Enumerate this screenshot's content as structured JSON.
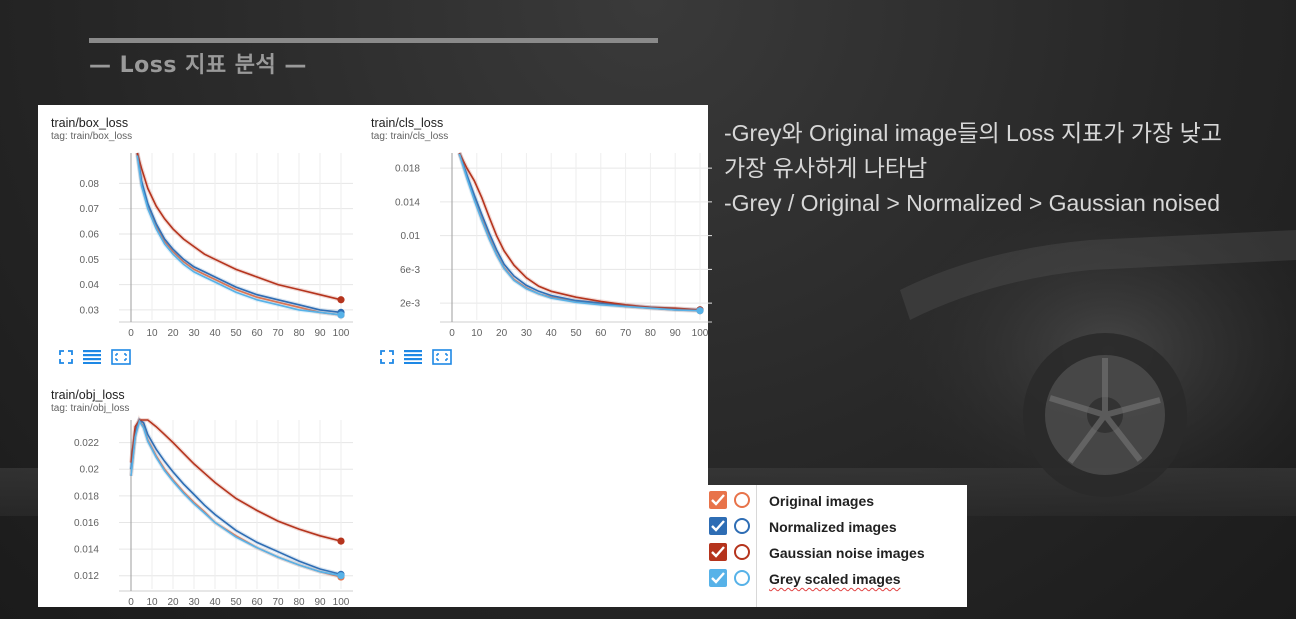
{
  "slide": {
    "title": "— Loss 지표 분석 —"
  },
  "description": {
    "line1": "-Grey와 Original image들의 Loss 지표가 가장 낮고",
    "line2": "가장 유사하게 나타남",
    "line3": "-Grey / Original > Normalized > Gaussian noised"
  },
  "legend": {
    "items": [
      {
        "label": "Original images",
        "color": "#e8734a",
        "checked": true
      },
      {
        "label": "Normalized images",
        "color": "#2e6db4",
        "checked": true
      },
      {
        "label": "Gaussian noise images",
        "color": "#b5341d",
        "checked": true
      },
      {
        "label": "Grey scaled images",
        "color": "#57b2e8",
        "checked": true
      }
    ]
  },
  "controls": {
    "icons": [
      "expand-icon",
      "list-icon",
      "fit-domain-icon"
    ]
  },
  "chart_data": [
    {
      "type": "line",
      "title": "train/box_loss",
      "tag": "tag: train/box_loss",
      "xlim": [
        0,
        100
      ],
      "ylim": [
        0.026,
        0.092
      ],
      "x_ticks": [
        0,
        10,
        20,
        30,
        40,
        50,
        60,
        70,
        80,
        90,
        100
      ],
      "y_ticks": [
        0.03,
        0.04,
        0.05,
        0.06,
        0.07,
        0.08
      ],
      "y_tick_labels": [
        "0.03",
        "0.04",
        "0.05",
        "0.06",
        "0.07",
        "0.08"
      ],
      "x": [
        3,
        5,
        8,
        12,
        16,
        20,
        25,
        30,
        35,
        40,
        50,
        60,
        70,
        80,
        90,
        100
      ],
      "series": [
        {
          "color": "#e8734a",
          "values": [
            0.092,
            0.08,
            0.071,
            0.063,
            0.057,
            0.053,
            0.049,
            0.046,
            0.044,
            0.042,
            0.038,
            0.035,
            0.033,
            0.031,
            0.029,
            0.028
          ]
        },
        {
          "color": "#2e6db4",
          "values": [
            0.092,
            0.081,
            0.072,
            0.064,
            0.058,
            0.054,
            0.05,
            0.047,
            0.045,
            0.043,
            0.039,
            0.036,
            0.034,
            0.032,
            0.03,
            0.029
          ]
        },
        {
          "color": "#b5341d",
          "values": [
            0.092,
            0.086,
            0.078,
            0.071,
            0.066,
            0.062,
            0.058,
            0.055,
            0.052,
            0.05,
            0.046,
            0.043,
            0.04,
            0.038,
            0.036,
            0.034
          ]
        },
        {
          "color": "#57b2e8",
          "values": [
            0.091,
            0.079,
            0.07,
            0.062,
            0.056,
            0.052,
            0.048,
            0.045,
            0.043,
            0.041,
            0.037,
            0.034,
            0.032,
            0.03,
            0.029,
            0.028
          ]
        }
      ]
    },
    {
      "type": "line",
      "title": "train/cls_loss",
      "tag": "tag: train/cls_loss",
      "xlim": [
        0,
        100
      ],
      "ylim": [
        0,
        0.0198
      ],
      "x_ticks": [
        0,
        10,
        20,
        30,
        40,
        50,
        60,
        70,
        80,
        90,
        100
      ],
      "y_ticks": [
        0.002,
        0.006,
        0.01,
        0.014,
        0.018
      ],
      "y_tick_labels": [
        "2e-3",
        "6e-3",
        "0.01",
        "0.014",
        "0.018"
      ],
      "x": [
        3,
        6,
        9,
        12,
        15,
        18,
        21,
        25,
        30,
        35,
        40,
        50,
        60,
        70,
        80,
        90,
        100
      ],
      "series": [
        {
          "color": "#e8734a",
          "values": [
            0.0198,
            0.017,
            0.0145,
            0.012,
            0.0098,
            0.0078,
            0.0062,
            0.0048,
            0.0038,
            0.0031,
            0.0027,
            0.0022,
            0.0019,
            0.0016,
            0.0014,
            0.0012,
            0.0011
          ]
        },
        {
          "color": "#2e6db4",
          "values": [
            0.0198,
            0.0172,
            0.0148,
            0.0125,
            0.0103,
            0.0083,
            0.0066,
            0.0052,
            0.0041,
            0.0034,
            0.0029,
            0.0023,
            0.002,
            0.0017,
            0.0015,
            0.0013,
            0.0012
          ]
        },
        {
          "color": "#b5341d",
          "values": [
            0.0198,
            0.018,
            0.0165,
            0.0145,
            0.0122,
            0.01,
            0.0082,
            0.0065,
            0.005,
            0.004,
            0.0034,
            0.0027,
            0.0022,
            0.0018,
            0.0015,
            0.0014,
            0.0012
          ]
        },
        {
          "color": "#57b2e8",
          "values": [
            0.0197,
            0.0168,
            0.0142,
            0.0118,
            0.0096,
            0.0077,
            0.0061,
            0.0047,
            0.0037,
            0.0031,
            0.0026,
            0.0021,
            0.0018,
            0.0016,
            0.0014,
            0.0012,
            0.0011
          ]
        }
      ]
    },
    {
      "type": "line",
      "title": "train/obj_loss",
      "tag": "tag: train/obj_loss",
      "xlim": [
        0,
        100
      ],
      "ylim": [
        0.011,
        0.0237
      ],
      "x_ticks": [
        0,
        10,
        20,
        30,
        40,
        50,
        60,
        70,
        80,
        90,
        100
      ],
      "y_ticks": [
        0.012,
        0.014,
        0.016,
        0.018,
        0.02,
        0.022
      ],
      "y_tick_labels": [
        "0.012",
        "0.014",
        "0.016",
        "0.018",
        "0.02",
        "0.022"
      ],
      "x": [
        0,
        2,
        4,
        6,
        8,
        12,
        16,
        20,
        25,
        30,
        35,
        40,
        50,
        60,
        70,
        80,
        90,
        100
      ],
      "series": [
        {
          "color": "#e8734a",
          "values": [
            0.0195,
            0.0225,
            0.0237,
            0.0232,
            0.0222,
            0.021,
            0.02,
            0.0192,
            0.0183,
            0.0175,
            0.0168,
            0.016,
            0.015,
            0.0141,
            0.0134,
            0.0128,
            0.0123,
            0.0119
          ]
        },
        {
          "color": "#2e6db4",
          "values": [
            0.02,
            0.0228,
            0.0237,
            0.0235,
            0.0226,
            0.0215,
            0.0206,
            0.0198,
            0.0189,
            0.0181,
            0.0173,
            0.0166,
            0.0154,
            0.0145,
            0.0138,
            0.0131,
            0.0125,
            0.0121
          ]
        },
        {
          "color": "#b5341d",
          "values": [
            0.0205,
            0.0232,
            0.0237,
            0.0237,
            0.0237,
            0.0232,
            0.0226,
            0.022,
            0.0212,
            0.0204,
            0.0197,
            0.019,
            0.0178,
            0.0169,
            0.0161,
            0.0155,
            0.015,
            0.0146
          ]
        },
        {
          "color": "#57b2e8",
          "values": [
            0.0195,
            0.0224,
            0.0236,
            0.0231,
            0.0221,
            0.0209,
            0.0199,
            0.0191,
            0.0182,
            0.0174,
            0.0167,
            0.016,
            0.0149,
            0.0141,
            0.0134,
            0.0128,
            0.0123,
            0.012
          ]
        }
      ]
    }
  ]
}
